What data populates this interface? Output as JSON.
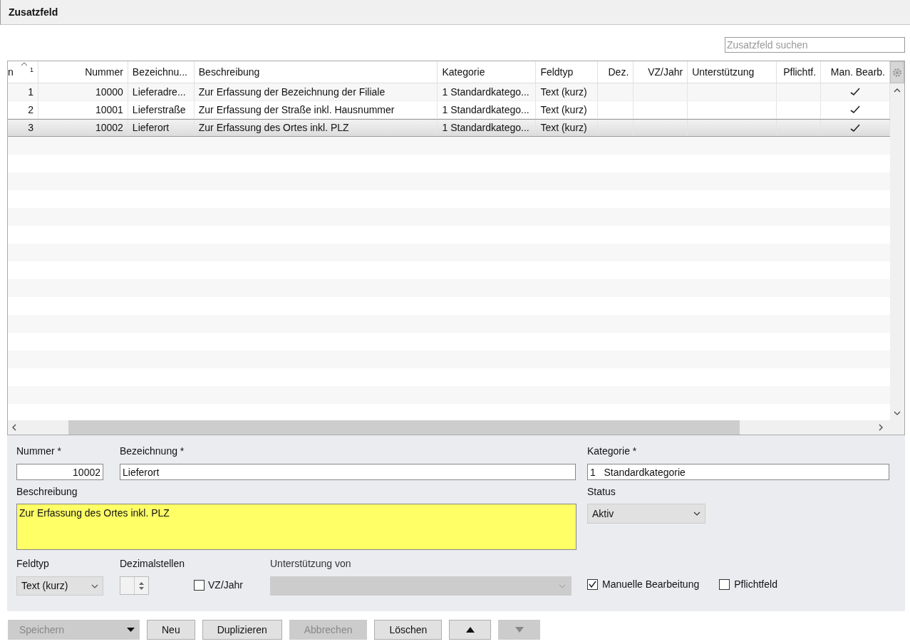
{
  "window": {
    "title": "Zusatzfeld"
  },
  "search": {
    "placeholder": "Zusatzfeld suchen"
  },
  "table": {
    "sort_order": "1",
    "columns": [
      {
        "label": "n"
      },
      {
        "label": "Nummer"
      },
      {
        "label": "Bezeichnu..."
      },
      {
        "label": "Beschreibung"
      },
      {
        "label": "Kategorie"
      },
      {
        "label": "Feldtyp"
      },
      {
        "label": "Dez."
      },
      {
        "label": "VZ/Jahr"
      },
      {
        "label": "Unterstützung"
      },
      {
        "label": "Pflichtf."
      },
      {
        "label": "Man. Bearb."
      }
    ],
    "rows": [
      {
        "n": "1",
        "nummer": "10000",
        "bezeichnung": "Lieferadre...",
        "beschreibung": "Zur Erfassung der Bezeichnung der Filiale",
        "kategorie": "1 Standardkatego...",
        "feldtyp": "Text (kurz)",
        "pflichtfeld": false,
        "manuelle_bearbeitung": true,
        "selected": false
      },
      {
        "n": "2",
        "nummer": "10001",
        "bezeichnung": "Lieferstraße",
        "beschreibung": "Zur Erfassung der Straße inkl. Hausnummer",
        "kategorie": "1 Standardkatego...",
        "feldtyp": "Text (kurz)",
        "pflichtfeld": false,
        "manuelle_bearbeitung": true,
        "selected": false
      },
      {
        "n": "3",
        "nummer": "10002",
        "bezeichnung": "Lieferort",
        "beschreibung": "Zur Erfassung des Ortes inkl. PLZ",
        "kategorie": "1 Standardkatego...",
        "feldtyp": "Text (kurz)",
        "pflichtfeld": false,
        "manuelle_bearbeitung": true,
        "selected": true
      }
    ]
  },
  "form": {
    "nummer": {
      "label": "Nummer *",
      "value": "10002"
    },
    "bezeichnung": {
      "label": "Bezeichnung *",
      "value": "Lieferort"
    },
    "kategorie": {
      "label": "Kategorie *",
      "value": "1   Standardkategorie"
    },
    "beschreibung": {
      "label": "Beschreibung",
      "value": "Zur Erfassung des Ortes inkl. PLZ"
    },
    "status": {
      "label": "Status",
      "value": "Aktiv"
    },
    "feldtyp": {
      "label": "Feldtyp",
      "value": "Text (kurz)"
    },
    "dezimalstellen": {
      "label": "Dezimalstellen"
    },
    "vz_jahr": {
      "label": "VZ/Jahr",
      "checked": false
    },
    "unterstuetzung": {
      "label": "Unterstützung von",
      "disabled": true
    },
    "manuelle_bearbeitung": {
      "label": "Manuelle Bearbeitung",
      "checked": true
    },
    "pflichtfeld": {
      "label": "Pflichtfeld",
      "checked": false
    }
  },
  "buttons": [
    {
      "kind": "split",
      "label": "Speichern",
      "disabled": true
    },
    {
      "kind": "text",
      "label": "Neu",
      "disabled": false
    },
    {
      "kind": "text",
      "label": "Duplizieren",
      "disabled": false
    },
    {
      "kind": "text",
      "label": "Abbrechen",
      "disabled": true
    },
    {
      "kind": "text",
      "label": "Löschen",
      "disabled": false
    },
    {
      "kind": "up",
      "disabled": false
    },
    {
      "kind": "down",
      "disabled": true
    }
  ]
}
